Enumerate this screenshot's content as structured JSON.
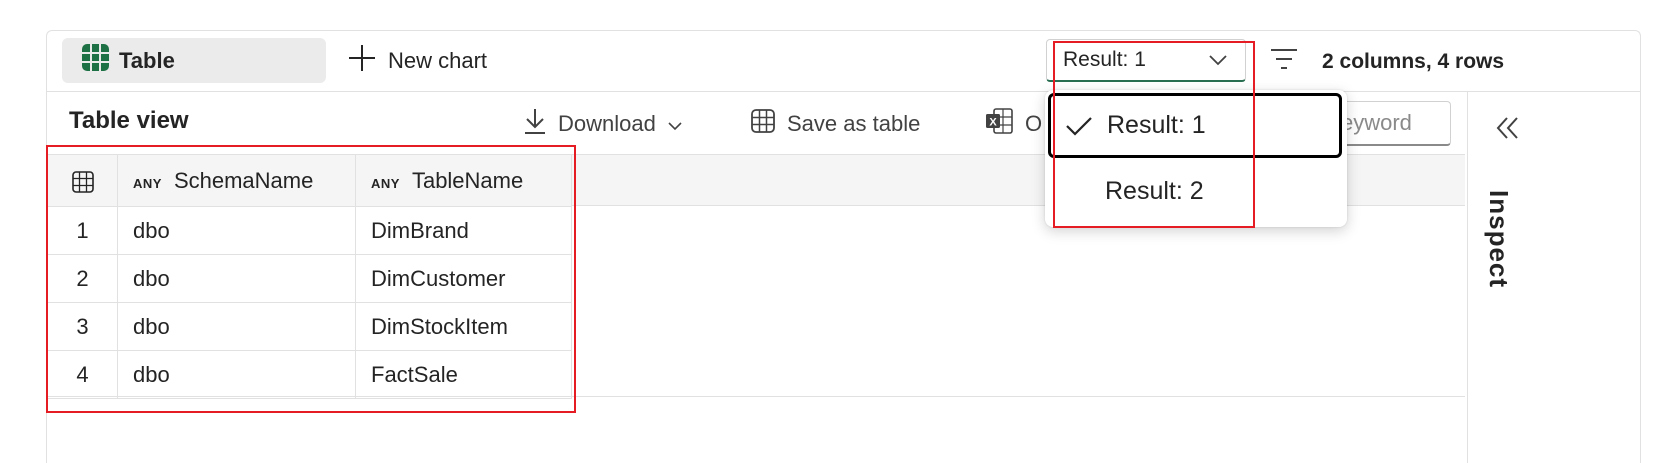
{
  "toolbar": {
    "table_tab_label": "Table",
    "new_chart_label": "New chart",
    "result_select_value": "Result: 1",
    "summary": "2 columns, 4 rows"
  },
  "table_view": {
    "title": "Table view",
    "download_label": "Download",
    "save_as_table_label": "Save as table",
    "excel_label_partial": "O",
    "keyword_placeholder": "eyword"
  },
  "inspect_panel": {
    "label": "Inspect"
  },
  "dropdown": {
    "options": [
      {
        "label": "Result: 1",
        "selected": true
      },
      {
        "label": "Result: 2",
        "selected": false
      }
    ]
  },
  "grid": {
    "type_badge": "ANY",
    "columns": [
      "SchemaName",
      "TableName"
    ],
    "rows": [
      {
        "num": "1",
        "schema": "dbo",
        "table": "DimBrand"
      },
      {
        "num": "2",
        "schema": "dbo",
        "table": "DimCustomer"
      },
      {
        "num": "3",
        "schema": "dbo",
        "table": "DimStockItem"
      },
      {
        "num": "4",
        "schema": "dbo",
        "table": "FactSale"
      }
    ]
  },
  "colors": {
    "accent_green": "#2a6f52",
    "table_icon_green": "#1e7145",
    "highlight_red": "#e51c23"
  }
}
